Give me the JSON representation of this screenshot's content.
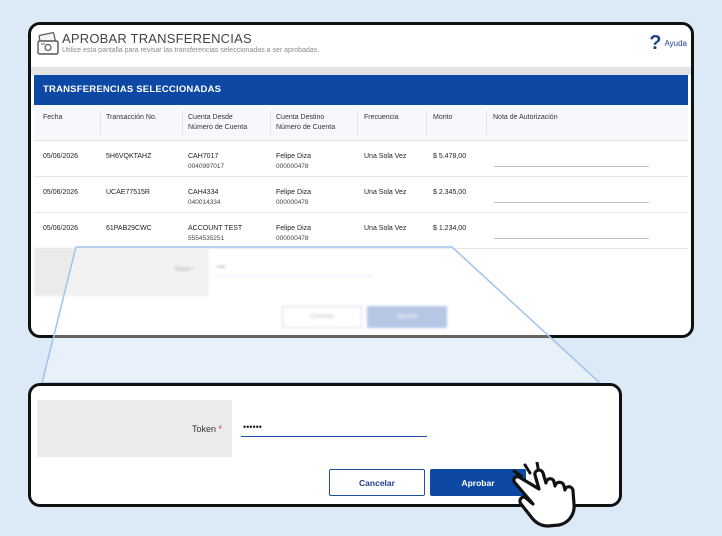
{
  "header": {
    "title": "APROBAR TRANSFERENCIAS",
    "subtitle": "Utilice esta pantalla para revisar las transferencias seleccionadas a ser aprobadas.",
    "help_label": "Ayuda",
    "help_icon": "question-mark-icon",
    "page_icon": "transfer-document-icon"
  },
  "section": {
    "title": "TRANSFERENCIAS SELECCIONADAS"
  },
  "table": {
    "columns": [
      {
        "label": "Fecha",
        "sub": ""
      },
      {
        "label": "Transacción No.",
        "sub": ""
      },
      {
        "label": "Cuenta Desde",
        "sub": "Número de Cuenta"
      },
      {
        "label": "Cuenta Destino",
        "sub": "Número de Cuenta"
      },
      {
        "label": "Frecuencia",
        "sub": ""
      },
      {
        "label": "Monto",
        "sub": ""
      },
      {
        "label": "Nota de Autorización",
        "sub": ""
      }
    ],
    "rows": [
      {
        "fecha": "05/06/2026",
        "transaccion": "5H6VQKTAHZ",
        "desde": "CAH7017",
        "desde_num": "0040997017",
        "destino": "Felipe Diza",
        "destino_num": "000000478",
        "frecuencia": "Una Sola Vez",
        "monto": "$ 5.478,00"
      },
      {
        "fecha": "05/06/2026",
        "transaccion": "UCAE77515R",
        "desde": "CAH4334",
        "desde_num": "040014334",
        "destino": "Felipe Diza",
        "destino_num": "000000478",
        "frecuencia": "Una Sola Vez",
        "monto": "$ 2.345,00"
      },
      {
        "fecha": "05/06/2026",
        "transaccion": "61PAB29CWC",
        "desde": "ACCOUNT TEST",
        "desde_num": "5554535251",
        "destino": "Felipe Diza",
        "destino_num": "000000478",
        "frecuencia": "Una Sola Vez",
        "monto": "$ 1.234,00"
      }
    ]
  },
  "background_form": {
    "token_label": "Token *",
    "token_value": "••••",
    "cancel_label": "Cancelar",
    "approve_label": "Aprobar"
  },
  "zoom_form": {
    "token_label": "Token",
    "required_mark": "*",
    "token_value": "••••••",
    "cancel_label": "Cancelar",
    "approve_label": "Aprobar"
  },
  "colors": {
    "primary": "#0e48a5",
    "background": "#dce9f7",
    "required": "#d32f2f",
    "frame": "#111111"
  },
  "cursor_icon": "pointing-hand-cursor-icon"
}
